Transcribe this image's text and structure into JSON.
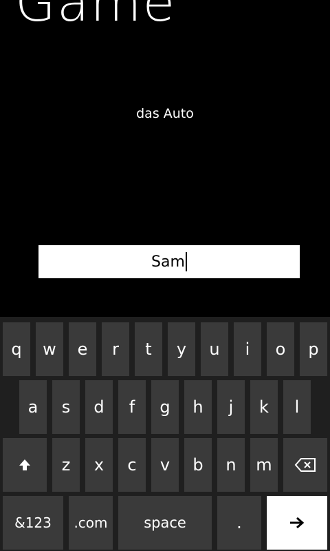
{
  "app": {
    "title": "Game"
  },
  "game": {
    "prompt_word": "das Auto",
    "answer_value": "Sam"
  },
  "keyboard": {
    "row1": [
      "q",
      "w",
      "e",
      "r",
      "t",
      "y",
      "u",
      "i",
      "o",
      "p"
    ],
    "row2": [
      "a",
      "s",
      "d",
      "f",
      "g",
      "h",
      "j",
      "k",
      "l"
    ],
    "row3": [
      "z",
      "x",
      "c",
      "v",
      "b",
      "n",
      "m"
    ],
    "mode_label": "&123",
    "dotcom_label": ".com",
    "space_label": "space",
    "period_label": ".",
    "shift_icon": "shift-arrow-up",
    "backspace_icon": "backspace",
    "enter_icon": "arrow-right"
  },
  "colors": {
    "background": "#000000",
    "keyboard_background": "#1f1f1f",
    "key_fill": "#3a3a3a",
    "enter_key_fill": "#ffffff",
    "text": "#ffffff"
  }
}
